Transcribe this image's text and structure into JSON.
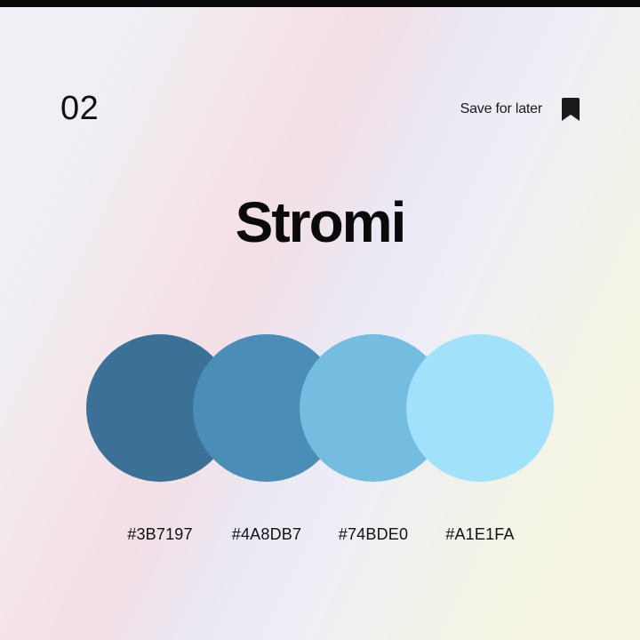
{
  "header": {
    "number": "02",
    "save_label": "Save for later",
    "save_icon": "bookmark-icon"
  },
  "palette": {
    "name": "Stromi",
    "colors": [
      {
        "hex": "#3B7197",
        "label": "#3B7197"
      },
      {
        "hex": "#4A8DB7",
        "label": "#4A8DB7"
      },
      {
        "hex": "#74BDE0",
        "label": "#74BDE0"
      },
      {
        "hex": "#A1E1FA",
        "label": "#A1E1FA"
      }
    ]
  }
}
